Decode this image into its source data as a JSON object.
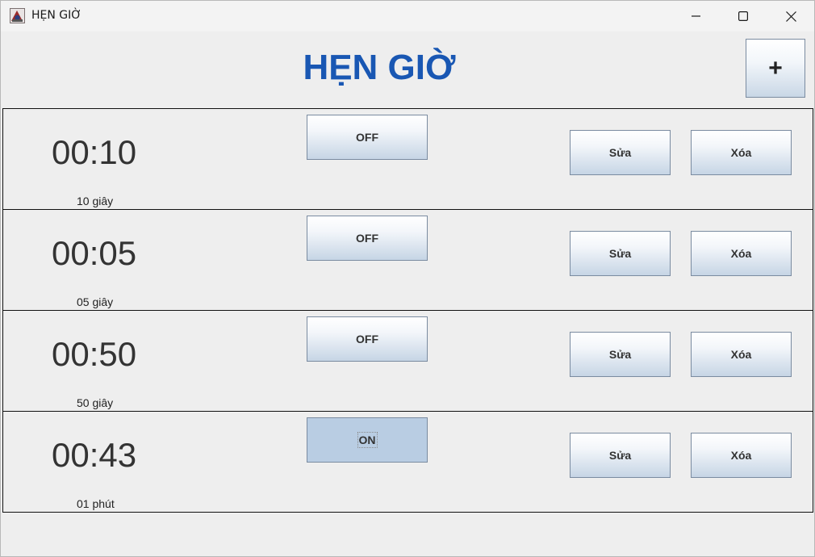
{
  "window": {
    "title": "HẸN GIỜ"
  },
  "header": {
    "title": "HẸN GIỜ",
    "add_label": "+",
    "title_color": "#1957b3"
  },
  "timers": [
    {
      "time": "00:10",
      "label": "10 giây",
      "toggle": "OFF",
      "on": false,
      "edit": "Sửa",
      "delete": "Xóa"
    },
    {
      "time": "00:05",
      "label": "05 giây",
      "toggle": "OFF",
      "on": false,
      "edit": "Sửa",
      "delete": "Xóa"
    },
    {
      "time": "00:50",
      "label": "50 giây",
      "toggle": "OFF",
      "on": false,
      "edit": "Sửa",
      "delete": "Xóa"
    },
    {
      "time": "00:43",
      "label": "01 phút",
      "toggle": "ON",
      "on": true,
      "edit": "Sửa",
      "delete": "Xóa"
    }
  ],
  "icons": {
    "app": "clock-app-icon",
    "minimize": "minimize-icon",
    "maximize": "maximize-icon",
    "close": "close-icon"
  }
}
